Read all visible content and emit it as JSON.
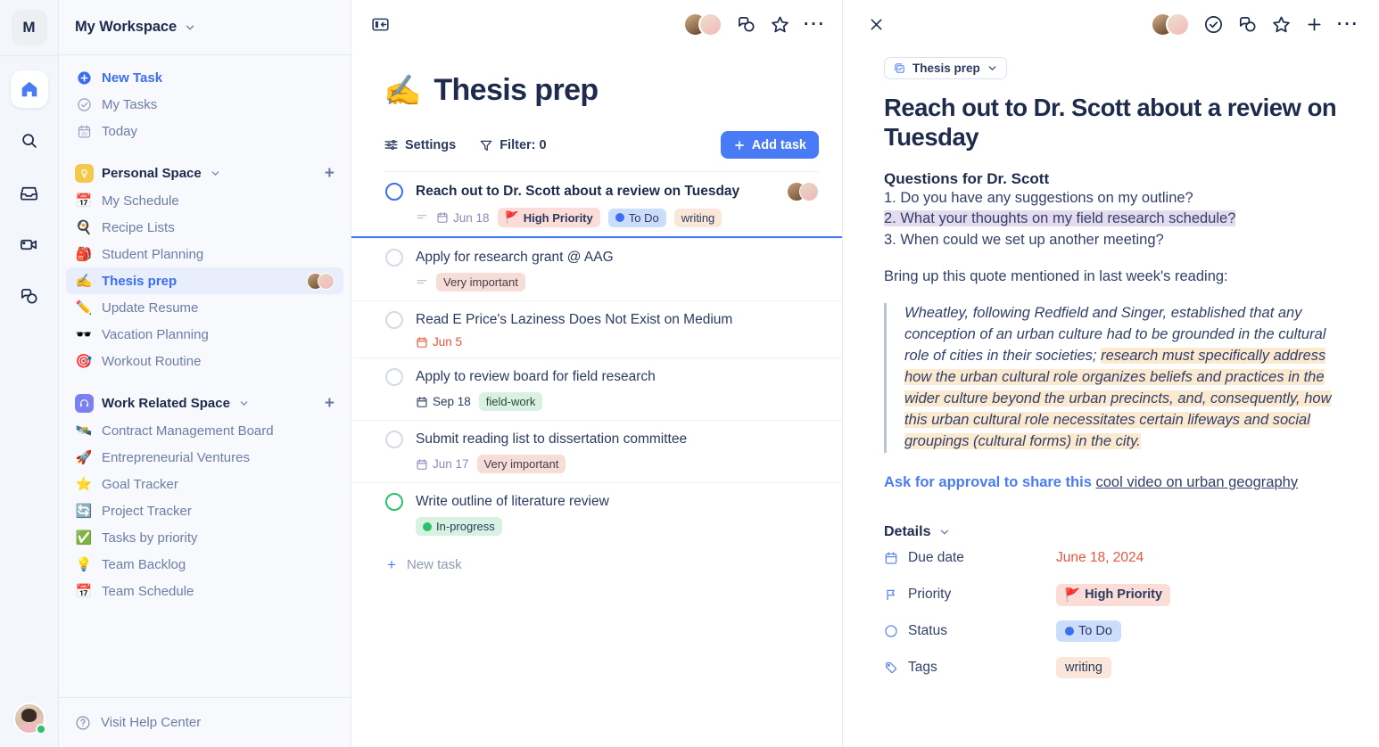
{
  "rail": {
    "logo": "M",
    "items": [
      {
        "name": "home-icon",
        "label": "Home",
        "active": true
      },
      {
        "name": "search-icon",
        "label": "Search",
        "active": false
      },
      {
        "name": "inbox-icon",
        "label": "Inbox",
        "active": false
      },
      {
        "name": "video-icon",
        "label": "Video",
        "active": false
      },
      {
        "name": "chat-icon",
        "label": "Chat",
        "active": false
      }
    ],
    "user_status": "online"
  },
  "sidebar": {
    "workspace_title": "My Workspace",
    "quick_links": [
      {
        "label": "New Task",
        "icon": "plus-circle-icon"
      },
      {
        "label": "My Tasks",
        "icon": "check-circle-icon"
      },
      {
        "label": "Today",
        "icon": "calendar-20-icon"
      }
    ],
    "spaces": [
      {
        "title": "Personal Space",
        "icon": "lightbulb-badge-icon",
        "items": [
          {
            "emoji": "📅",
            "label": "My Schedule"
          },
          {
            "emoji": "🍳",
            "label": "Recipe Lists"
          },
          {
            "emoji": "🎒",
            "label": "Student Planning"
          },
          {
            "emoji": "✍️",
            "label": "Thesis prep",
            "active": true,
            "avatars": true
          },
          {
            "emoji": "✏️",
            "label": "Update Resume"
          },
          {
            "emoji": "🕶️",
            "label": "Vacation Planning"
          },
          {
            "emoji": "🎯",
            "label": "Workout Routine"
          }
        ]
      },
      {
        "title": "Work Related Space",
        "icon": "headset-badge-icon",
        "items": [
          {
            "emoji": "🛰️",
            "label": "Contract Management Board"
          },
          {
            "emoji": "🚀",
            "label": "Entrepreneurial Ventures"
          },
          {
            "emoji": "⭐",
            "label": "Goal Tracker"
          },
          {
            "emoji": "🔄",
            "label": "Project Tracker"
          },
          {
            "emoji": "✅",
            "label": "Tasks by priority"
          },
          {
            "emoji": "💡",
            "label": "Team Backlog"
          },
          {
            "emoji": "📅",
            "label": "Team Schedule"
          }
        ]
      }
    ],
    "footer": {
      "label": "Visit Help Center",
      "icon": "question-circle-icon"
    }
  },
  "middle": {
    "collapse_icon": "collapse-panel-icon",
    "top_icons": [
      "chat-icon",
      "star-icon",
      "more-icon"
    ],
    "emoji": "✍️",
    "title": "Thesis prep",
    "toolbar": {
      "settings_label": "Settings",
      "filter_label": "Filter: 0",
      "add_task_label": "Add task"
    },
    "new_task_label": "New task",
    "tasks": [
      {
        "title": "Reach out to Dr. Scott about a review on Tuesday",
        "selected": true,
        "circle": "blue",
        "has_description": true,
        "avatars": true,
        "date": "Jun 18",
        "date_style": "purple",
        "chips": [
          {
            "type": "prio",
            "label": "High Priority",
            "icon": "🚩"
          },
          {
            "type": "todo",
            "label": "To Do",
            "icon": "dot-blue"
          },
          {
            "type": "writing",
            "label": "writing"
          }
        ]
      },
      {
        "title": "Apply for research grant @ AAG",
        "selected": false,
        "circle": "gray",
        "has_description": true,
        "avatars": false,
        "date": "",
        "chips": [
          {
            "type": "veryimp",
            "label": "Very important"
          }
        ]
      },
      {
        "title": "Read E Price's Laziness Does Not Exist on Medium",
        "selected": false,
        "circle": "gray",
        "has_description": false,
        "avatars": false,
        "date": "Jun 5",
        "date_style": "red",
        "chips": []
      },
      {
        "title": "Apply to review board for field research",
        "selected": false,
        "circle": "gray",
        "has_description": false,
        "avatars": false,
        "date": "Sep 18",
        "date_style": "dark",
        "chips": [
          {
            "type": "fieldwork",
            "label": "field-work"
          }
        ]
      },
      {
        "title": "Submit reading list to dissertation committee",
        "selected": false,
        "circle": "gray",
        "has_description": false,
        "avatars": false,
        "date": "Jun 17",
        "date_style": "purple",
        "chips": [
          {
            "type": "veryimp",
            "label": "Very important"
          }
        ]
      },
      {
        "title": "Write outline of literature review",
        "selected": false,
        "circle": "green",
        "has_description": false,
        "avatars": false,
        "date": "",
        "chips": [
          {
            "type": "inprog",
            "label": "In-progress",
            "icon": "dot-green"
          }
        ]
      }
    ]
  },
  "detail": {
    "close_icon": "close-icon",
    "top_icons": [
      "check-circle-icon",
      "chat-icon",
      "star-icon",
      "plus-icon",
      "more-icon"
    ],
    "project_chip": "Thesis prep",
    "title": "Reach out to Dr. Scott about a review on Tuesday",
    "section_heading": "Questions for Dr. Scott",
    "questions": [
      {
        "text": "1. Do you have any suggestions on my outline?",
        "highlight": false
      },
      {
        "text": "2. What your thoughts on my field research schedule?",
        "highlight": true
      },
      {
        "text": "3. When could we set up another meeting?",
        "highlight": false
      }
    ],
    "quote_intro": "Bring up this quote mentioned in last week's reading:",
    "quote_plain": "Wheatley, following Redfield and Singer, established that any conception of an urban culture had to be grounded in the cultural role of cities in their societies; ",
    "quote_highlighted": "research must specifically address how the urban cultural role organizes beliefs and practices in the wider culture beyond the urban precincts, and, consequently, how this urban cultural role necessitates certain lifeways and social groupings (cultural forms) in the city.",
    "link_prefix": "Ask for approval to share this ",
    "link_text": "cool video on urban geography",
    "details_label": "Details",
    "fields": [
      {
        "icon": "calendar-icon",
        "label": "Due date",
        "value": "June 18, 2024",
        "kind": "due"
      },
      {
        "icon": "flag-icon",
        "label": "Priority",
        "value": "High Priority",
        "kind": "chip-prio"
      },
      {
        "icon": "circle-icon",
        "label": "Status",
        "value": "To Do",
        "kind": "chip-todo"
      },
      {
        "icon": "tag-icon",
        "label": "Tags",
        "value": "writing",
        "kind": "chip-writing"
      }
    ]
  },
  "colors": {
    "accent_blue": "#4a7bf7",
    "text_navy": "#1f2b4d",
    "sidebar_bg": "#f7f9fc",
    "due_red": "#e8553c",
    "highlight_amber": "#fbeacf",
    "highlight_purple": "#e4dcee"
  }
}
